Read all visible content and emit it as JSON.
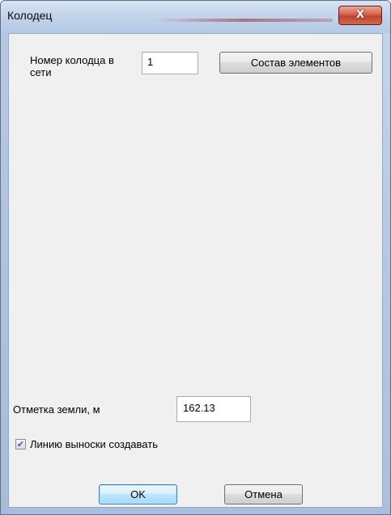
{
  "window": {
    "title": "Колодец",
    "close_glyph": "X"
  },
  "form": {
    "well_number_label": "Номер колодца в сети",
    "well_number_value": "1",
    "composition_button": "Состав элементов",
    "ground_level_label": "Отметка земли, м",
    "ground_level_value": "162.13",
    "leader_checkbox_label": "Линию выноски создавать",
    "leader_checkbox_checked": true,
    "checkbox_glyph": "✔"
  },
  "buttons": {
    "ok": "OK",
    "cancel": "Отмена"
  }
}
